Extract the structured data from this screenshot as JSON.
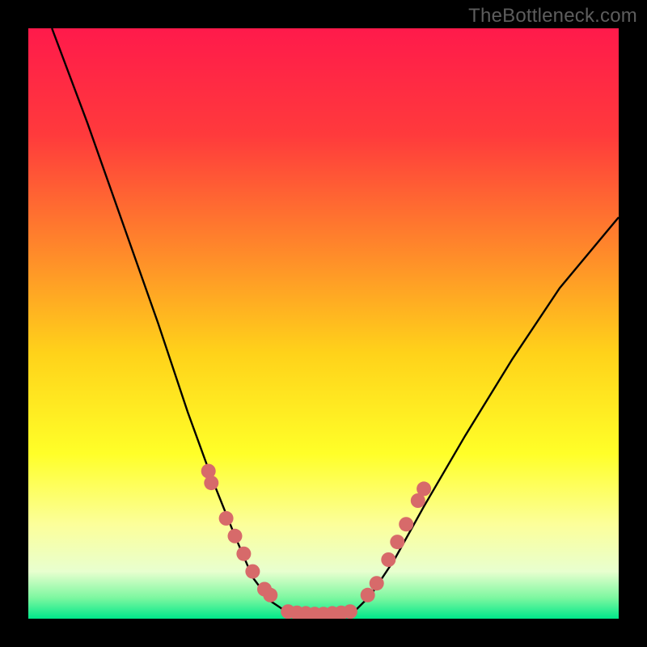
{
  "watermark": "TheBottleneck.com",
  "colors": {
    "frame": "#000000",
    "gradient_stops": [
      {
        "offset": 0.0,
        "color": "#ff1a4b"
      },
      {
        "offset": 0.18,
        "color": "#ff3a3c"
      },
      {
        "offset": 0.38,
        "color": "#ff8a2a"
      },
      {
        "offset": 0.55,
        "color": "#ffd21a"
      },
      {
        "offset": 0.72,
        "color": "#ffff28"
      },
      {
        "offset": 0.84,
        "color": "#fcff9a"
      },
      {
        "offset": 0.92,
        "color": "#e8ffcf"
      },
      {
        "offset": 0.965,
        "color": "#7cf7a0"
      },
      {
        "offset": 1.0,
        "color": "#00e88a"
      }
    ],
    "curve": "#000000",
    "marker_fill": "#d76a6a",
    "marker_stroke": "#b35656"
  },
  "chart_data": {
    "type": "line",
    "title": "",
    "xlabel": "",
    "ylabel": "",
    "xlim": [
      0,
      100
    ],
    "ylim": [
      0,
      100
    ],
    "curve_left": [
      {
        "x": 4,
        "y": 100
      },
      {
        "x": 10,
        "y": 84
      },
      {
        "x": 16,
        "y": 67
      },
      {
        "x": 22,
        "y": 50
      },
      {
        "x": 27,
        "y": 35
      },
      {
        "x": 31,
        "y": 24
      },
      {
        "x": 35,
        "y": 14
      },
      {
        "x": 38,
        "y": 7
      },
      {
        "x": 41,
        "y": 3
      },
      {
        "x": 44,
        "y": 1
      }
    ],
    "curve_bottom": [
      {
        "x": 44,
        "y": 1
      },
      {
        "x": 48,
        "y": 0.5
      },
      {
        "x": 52,
        "y": 0.5
      },
      {
        "x": 55,
        "y": 1
      }
    ],
    "curve_right": [
      {
        "x": 55,
        "y": 1
      },
      {
        "x": 58,
        "y": 4
      },
      {
        "x": 62,
        "y": 10
      },
      {
        "x": 67,
        "y": 19
      },
      {
        "x": 74,
        "y": 31
      },
      {
        "x": 82,
        "y": 44
      },
      {
        "x": 90,
        "y": 56
      },
      {
        "x": 100,
        "y": 68
      }
    ],
    "markers_left": [
      {
        "x": 30.5,
        "y": 25
      },
      {
        "x": 31.0,
        "y": 23
      },
      {
        "x": 33.5,
        "y": 17
      },
      {
        "x": 35.0,
        "y": 14
      },
      {
        "x": 36.5,
        "y": 11
      },
      {
        "x": 38.0,
        "y": 8
      },
      {
        "x": 40.0,
        "y": 5
      },
      {
        "x": 41.0,
        "y": 4
      }
    ],
    "markers_bottom": [
      {
        "x": 44.0,
        "y": 1.2
      },
      {
        "x": 45.5,
        "y": 1.0
      },
      {
        "x": 47.0,
        "y": 0.9
      },
      {
        "x": 48.5,
        "y": 0.8
      },
      {
        "x": 50.0,
        "y": 0.8
      },
      {
        "x": 51.5,
        "y": 0.9
      },
      {
        "x": 53.0,
        "y": 1.0
      },
      {
        "x": 54.5,
        "y": 1.2
      }
    ],
    "markers_right": [
      {
        "x": 57.5,
        "y": 4
      },
      {
        "x": 59.0,
        "y": 6
      },
      {
        "x": 61.0,
        "y": 10
      },
      {
        "x": 62.5,
        "y": 13
      },
      {
        "x": 64.0,
        "y": 16
      },
      {
        "x": 66.0,
        "y": 20
      },
      {
        "x": 67.0,
        "y": 22
      }
    ]
  }
}
